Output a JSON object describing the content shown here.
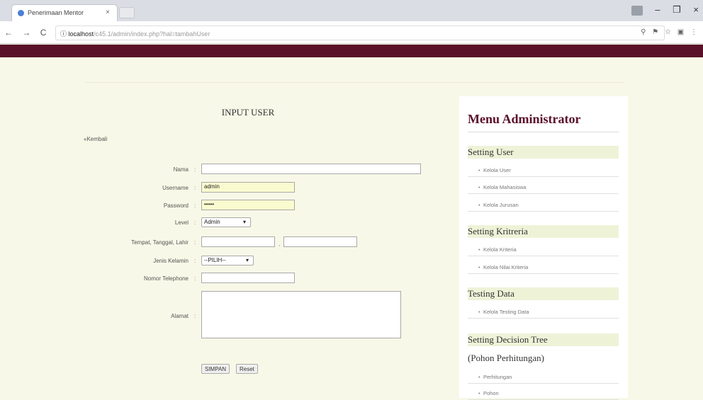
{
  "browser": {
    "tab_title": "Penerimaan Mentor",
    "tab_close": "×",
    "url_host": "localhost",
    "url_path": "/c45.1/admin/index.php?hal=tambahUser",
    "nav": {
      "back": "←",
      "forward": "→",
      "reload": "C",
      "info": "ⓘ"
    },
    "addr_icons": [
      "⚲",
      "⚑",
      "☆",
      "▣",
      "⋮"
    ],
    "window": {
      "minimize": "–",
      "maximize": "❐",
      "close": "×"
    }
  },
  "form": {
    "title": "INPUT USER",
    "back_link": "«Kembali",
    "fields": {
      "nama": {
        "label": "Nama",
        "value": ""
      },
      "username": {
        "label": "Username",
        "value": "admin"
      },
      "password": {
        "label": "Password",
        "value": "•••••"
      },
      "level": {
        "label": "Level",
        "value": "Admin"
      },
      "ttl": {
        "label": "Tempat, Tanggal, Lahir",
        "sep_between": ",",
        "tempat": "",
        "tanggal": ""
      },
      "jk": {
        "label": "Jenis Kelamin",
        "value": "--PILIH--"
      },
      "telp": {
        "label": "Nomor Telephone",
        "value": ""
      },
      "alamat": {
        "label": "Alamat",
        "value": ""
      }
    },
    "colon": ":",
    "buttons": {
      "simpan": "SIMPAN",
      "reset": "Reset"
    }
  },
  "sidebar": {
    "title": "Menu Administrator",
    "sections": [
      {
        "title": "Setting User",
        "items": [
          "Kelola User",
          "Kelola Mahasiswa",
          "Kelola Jurusan"
        ]
      },
      {
        "title": "Setting Kritreria",
        "items": [
          "Kelola Kriteria",
          "Kelola Nilai Kriteria"
        ]
      },
      {
        "title": "Testing Data",
        "items": [
          "Kelola Testing Data"
        ]
      },
      {
        "title": "Setting Decision Tree",
        "items": []
      },
      {
        "title": "(Pohon Perhitungan)",
        "items": [
          "Perhitungan",
          "Pohon"
        ]
      }
    ]
  },
  "colors": {
    "header": "#5a1028",
    "background": "#f8f8e8",
    "section_bg": "#eef3d8"
  }
}
